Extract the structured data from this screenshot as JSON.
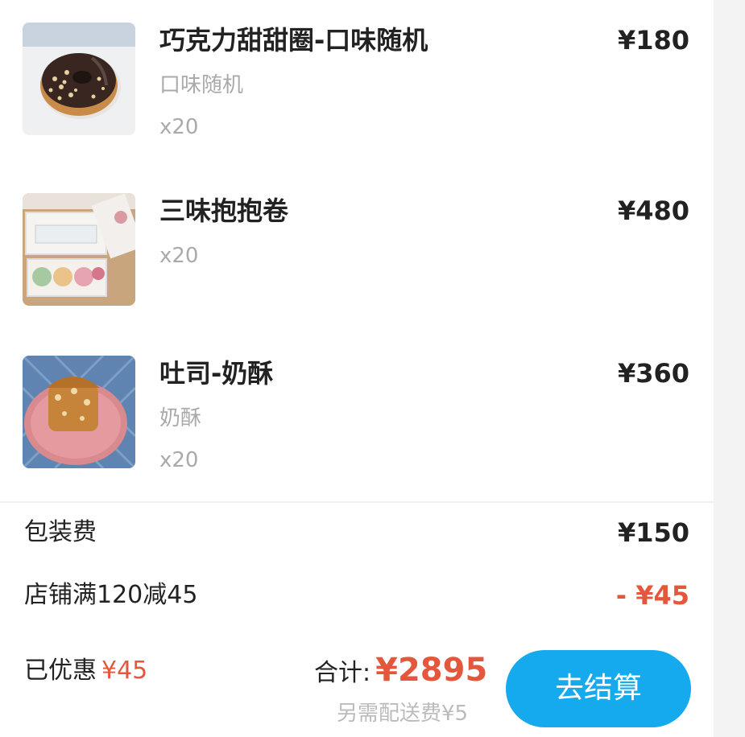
{
  "items": [
    {
      "name": "巧克力甜甜圈-口味随机",
      "spec": "口味随机",
      "qty": "x20",
      "price": "¥180"
    },
    {
      "name": "三味抱抱卷",
      "spec": "",
      "qty": "x20",
      "price": "¥480"
    },
    {
      "name": "吐司-奶酥",
      "spec": "奶酥",
      "qty": "x20",
      "price": "¥360"
    }
  ],
  "fees": {
    "packaging_label": "包装费",
    "packaging_value": "¥150",
    "discount_label": "店铺满120减45",
    "discount_value": "- ¥45"
  },
  "footer": {
    "saved_label": "已优惠",
    "saved_amount": "¥45",
    "total_label": "合计:",
    "total_amount": "¥2895",
    "delivery_note": "另需配送费¥5",
    "checkout_label": "去结算"
  },
  "colors": {
    "accent_red": "#e4573d",
    "checkout_blue": "#15a9ee"
  }
}
